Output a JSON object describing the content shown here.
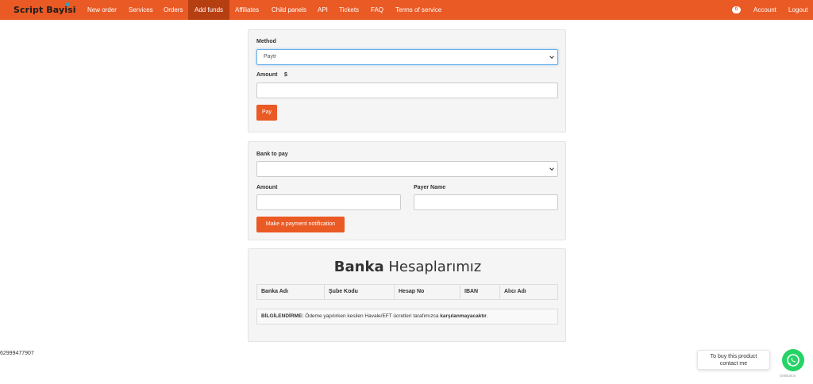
{
  "brand": "Script Bayisi",
  "nav": {
    "items": [
      "New order",
      "Services",
      "Orders",
      "Add funds",
      "Affiliates",
      "Child panels",
      "API",
      "Tickets",
      "FAQ",
      "Terms of service"
    ],
    "active": "Add funds",
    "badge": "0",
    "account": "Account",
    "logout": "Logout"
  },
  "colors": {
    "accent": "#ea5a24",
    "active_nav": "#b63f12",
    "whatsapp": "#25d366"
  },
  "add_funds": {
    "method_label": "Method",
    "method_value": "Paytr",
    "amount_label": "Amount",
    "amount_currency": "$",
    "amount_value": "",
    "pay_button": "Pay"
  },
  "notification": {
    "bank_label": "Bank to pay",
    "bank_value": "",
    "amount_label": "Amount",
    "payer_label": "Payer Name",
    "submit_button": "Make a payment notification"
  },
  "bank_accounts": {
    "title_bold": "Banka",
    "title_rest": " Hesaplarımız",
    "columns": [
      "Banka Adı",
      "Şube Kodu",
      "Hesap No",
      "IBAN",
      "Alıcı Adı"
    ],
    "info_prefix": "BİLGİLENDİRME:",
    "info_text": " Ödeme yapılırken kesilen Havale/EFT ücretleri tarafımızca ",
    "info_bold": "karşılanmayacaktır",
    "info_suffix": "."
  },
  "footer_number": "62999477907",
  "whatsapp": {
    "line1": "To buy this product",
    "line2": "contact me",
    "credit": "GetButton",
    "icon": "whatsapp-icon"
  }
}
